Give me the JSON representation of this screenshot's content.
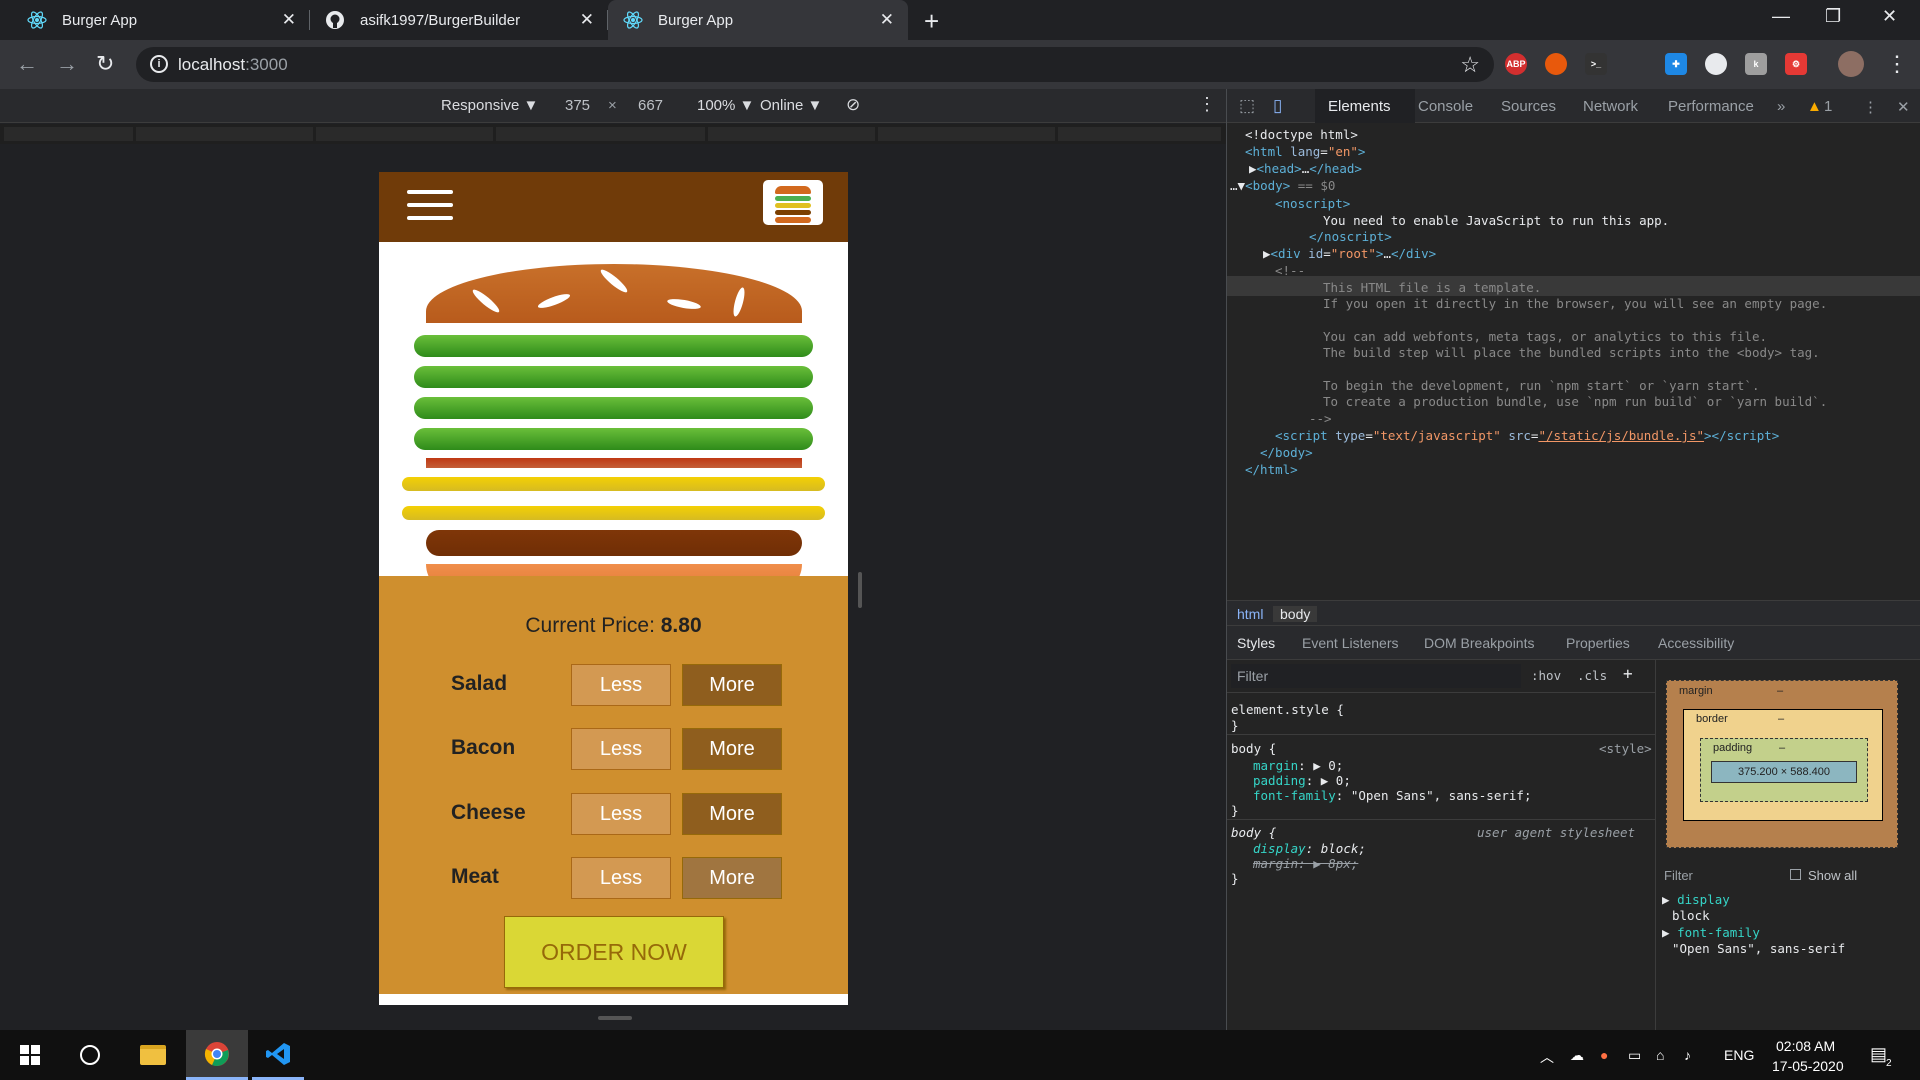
{
  "browser": {
    "tabs": [
      {
        "title": "Burger App",
        "icon": "react-icon",
        "active": false
      },
      {
        "title": "asifk1997/BurgerBuilder",
        "icon": "github-icon",
        "active": false
      },
      {
        "title": "Burger App",
        "icon": "react-icon",
        "active": true
      }
    ],
    "new_tab": "+",
    "url_host": "localhost",
    "url_port": ":3000",
    "extensions": [
      "ABP"
    ]
  },
  "device_toolbar": {
    "mode": "Responsive ▼",
    "width": "375",
    "times": "×",
    "height": "667",
    "zoom": "100% ▼",
    "network": "Online ▼"
  },
  "app": {
    "price_label": "Current Price: ",
    "price_value": "8.80",
    "controls": [
      {
        "label": "Salad",
        "less": "Less",
        "more": "More"
      },
      {
        "label": "Bacon",
        "less": "Less",
        "more": "More"
      },
      {
        "label": "Cheese",
        "less": "Less",
        "more": "More"
      },
      {
        "label": "Meat",
        "less": "Less",
        "more": "More"
      }
    ],
    "order_button": "ORDER NOW",
    "colors": {
      "header": "#703b09",
      "controls_bg": "#cf8f2e",
      "order_bg": "#dad735"
    }
  },
  "devtools": {
    "tabs": [
      "Elements",
      "Console",
      "Sources",
      "Network",
      "Performance",
      "»"
    ],
    "warning_count": "1",
    "breadcrumbs": [
      "html",
      "body"
    ],
    "subtabs": [
      "Styles",
      "Event Listeners",
      "DOM Breakpoints",
      "Properties",
      "Accessibility"
    ],
    "filter_placeholder": "Filter",
    "hov": ":hov",
    "cls": ".cls",
    "computed_filter_placeholder": "Filter",
    "show_all": "Show all",
    "box_model": {
      "margin": "margin",
      "border": "border",
      "padding": "padding",
      "content": "375.200 × 588.400",
      "dash": "–"
    },
    "computed": [
      {
        "prop": "display",
        "value": "block"
      },
      {
        "prop": "font-family",
        "value": "\"Open Sans\", sans-serif"
      }
    ]
  },
  "taskbar": {
    "lang": "ENG",
    "time": "02:08 AM",
    "date": "17-05-2020",
    "notifications": "2"
  }
}
